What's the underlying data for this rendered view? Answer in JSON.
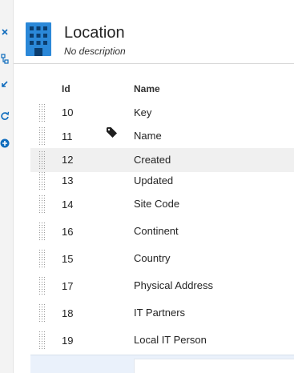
{
  "entity": {
    "title": "Location",
    "subtitle": "No description"
  },
  "table": {
    "headers": {
      "id": "Id",
      "name": "Name"
    },
    "rows": [
      {
        "id": "10",
        "name": "Key"
      },
      {
        "id": "11",
        "name": "Name",
        "icon": "tag-icon"
      },
      {
        "id": "12",
        "name": "Created",
        "selected": true
      },
      {
        "id": "13",
        "name": "Updated"
      },
      {
        "id": "14",
        "name": "Site Code"
      },
      {
        "id": "16",
        "name": "Continent"
      },
      {
        "id": "15",
        "name": "Country"
      },
      {
        "id": "17",
        "name": "Physical Address"
      },
      {
        "id": "18",
        "name": "IT Partners"
      },
      {
        "id": "19",
        "name": "Local IT Person"
      }
    ]
  },
  "rail": {
    "icons": [
      "collapse-icon",
      "hierarchy-icon",
      "arrow-down-left-icon",
      "refresh-icon",
      "add-circle-icon"
    ]
  },
  "colors": {
    "accent": "#0f6cbd",
    "entity_icon": "#2b88d8",
    "selected_row": "#f0f0f0"
  }
}
